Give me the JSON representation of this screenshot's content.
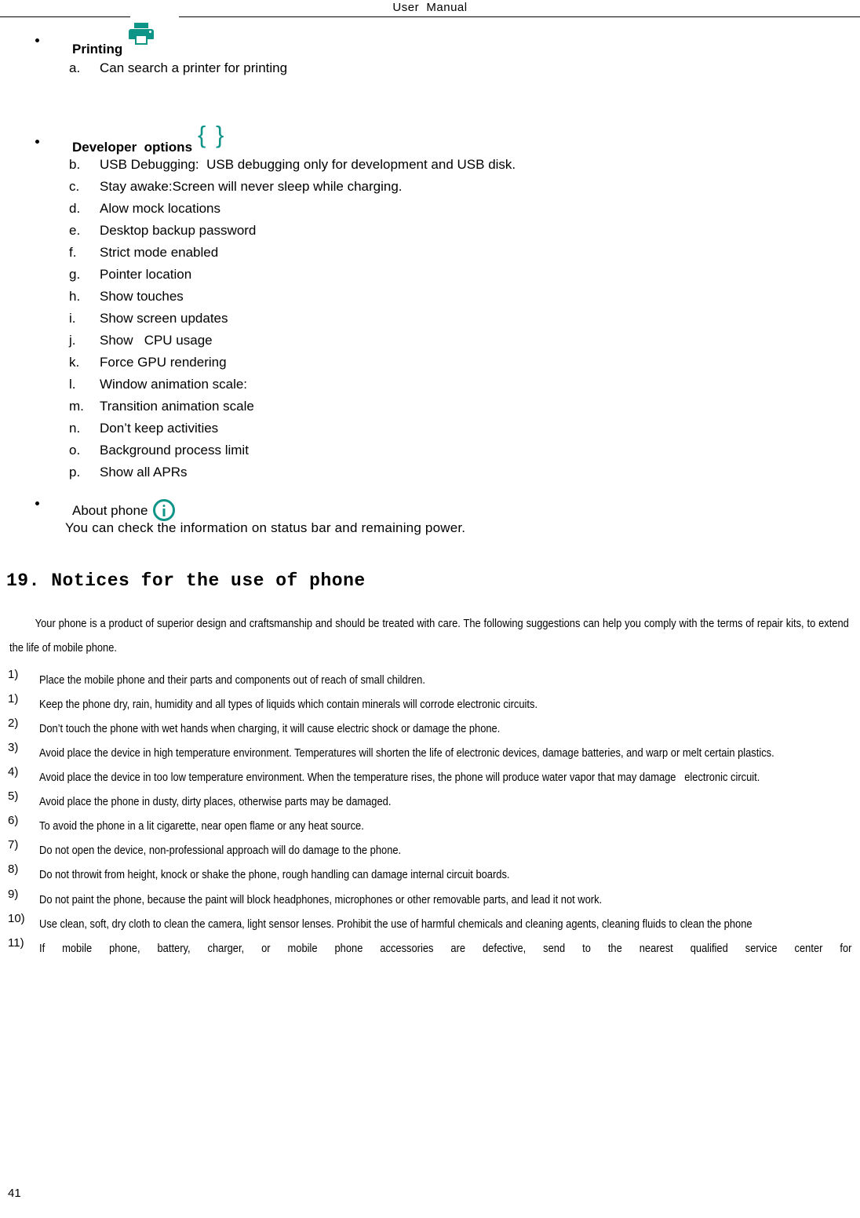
{
  "header": {
    "title": "User  Manual"
  },
  "settings_sections": [
    {
      "label": "Printing",
      "icon": "printer-icon",
      "items": [
        {
          "marker": "a.",
          "text": "Can search a printer for printing"
        }
      ]
    },
    {
      "label": "Developer  options",
      "icon": "curly-braces-icon",
      "items": [
        {
          "marker": "b.",
          "text": "USB Debugging:  USB debugging only for development and USB disk."
        },
        {
          "marker": "c.",
          "text": "Stay awake:Screen will never sleep while charging."
        },
        {
          "marker": "d.",
          "text": "Alow mock locations"
        },
        {
          "marker": "e.",
          "text": "Desktop backup password"
        },
        {
          "marker": "f.",
          "text": "Strict mode enabled"
        },
        {
          "marker": "g.",
          "text": "Pointer location"
        },
        {
          "marker": "h.",
          "text": "Show touches"
        },
        {
          "marker": "i.",
          "text": "Show screen updates"
        },
        {
          "marker": "j.",
          "text": "Show   CPU usage"
        },
        {
          "marker": "k.",
          "text": "Force GPU rendering"
        },
        {
          "marker": "l.",
          "text": "Window animation scale:"
        },
        {
          "marker": "m.",
          "text": "Transition animation scale"
        },
        {
          "marker": "n.",
          "text": "Don’t keep activities"
        },
        {
          "marker": "o.",
          "text": "Background process limit"
        },
        {
          "marker": "p.",
          "text": "Show all APRs"
        }
      ]
    }
  ],
  "about_phone": {
    "label": "About phone",
    "icon": "info-icon",
    "note": "You can check the information on status bar and remaining power."
  },
  "section": {
    "heading": "19. Notices for the use of phone",
    "intro": "Your phone is a product of superior design and craftsmanship and should be treated with care. The following suggestions can help you comply with the terms of repair kits, to extend the life of mobile phone.",
    "notices": [
      {
        "marker": "1)",
        "text": "Place the mobile phone and their parts and components out of reach of small children."
      },
      {
        "marker": "1)",
        "text": "Keep the phone dry, rain, humidity and all types of liquids which contain minerals will corrode electronic circuits."
      },
      {
        "marker": "2)",
        "text": "Don’t touch the phone with wet hands when charging, it will cause electric shock or damage the phone."
      },
      {
        "marker": "3)",
        "text": "Avoid place the device in high temperature environment. Temperatures will shorten the life of electronic devices, damage batteries, and warp or melt certain plastics."
      },
      {
        "marker": "4)",
        "text": "Avoid place the device in too low temperature environment. When the temperature rises, the phone will produce water vapor that may damage   electronic circuit."
      },
      {
        "marker": "5)",
        "text": "Avoid place the phone in dusty, dirty places, otherwise parts may be damaged."
      },
      {
        "marker": "6)",
        "text": "To avoid the phone in a lit cigarette, near open flame or any heat source."
      },
      {
        "marker": "7)",
        "text": "Do not open the device, non-professional approach will do damage to the phone."
      },
      {
        "marker": "8)",
        "text": "Do not throwit from height, knock or shake the phone, rough handling can damage internal circuit boards."
      },
      {
        "marker": "9)",
        "text": "Do not paint the phone, because the paint will block headphones, microphones or other removable parts, and lead it not work."
      },
      {
        "marker": "10)",
        "text": "Use clean, soft, dry cloth to clean the camera, light sensor lenses. Prohibit the use of harmful chemicals and cleaning agents, cleaning fluids to clean the phone"
      },
      {
        "marker": "11)",
        "text": "If mobile phone, battery, charger, or mobile phone accessories are defective, send to the nearest qualified service center for",
        "justified_last_line": true
      }
    ]
  },
  "footer": {
    "page_number": "41"
  },
  "colors": {
    "icon_teal": "#0f9488",
    "text": "#000000",
    "background": "#ffffff"
  }
}
